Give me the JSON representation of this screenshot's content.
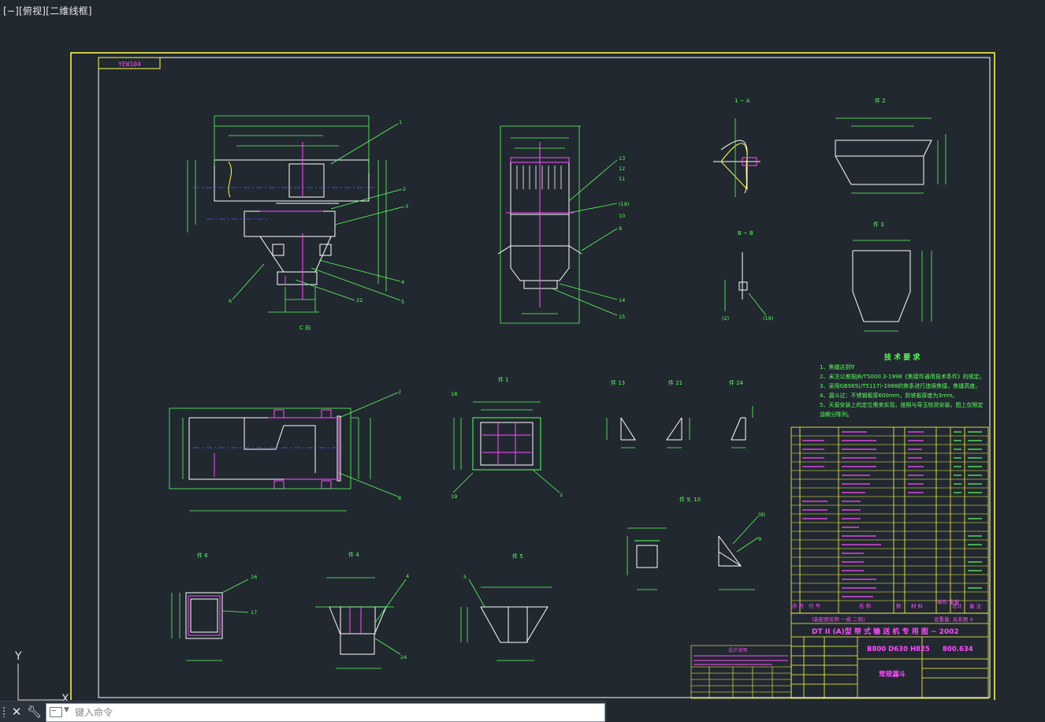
{
  "viewport": {
    "label": "[−][俯视][二维线框]"
  },
  "command_line": {
    "placeholder": "键入命令"
  },
  "ucs": {
    "y_label": "Y",
    "x_label": "X"
  },
  "drawing": {
    "corner_tag": "YEW104",
    "tech_title": "技 术 要 求",
    "tech_requirements": [
      "1、焦缝达到∇",
      "2、未注公差按JB/T5000.3-1998《焦接件通用技术条件》的规定。",
      "3、采用GB985(/T5117)-1988的焦条进行连续焦接，焦缝高度。",
      "4、漏斗过：不锈钢板厚600mm，防铁板厚度为3mm。",
      "5、天窗安装上的定位需来实现，按照与导玉校测安装，图上仅限定",
      "油稀分陈列。"
    ],
    "section_labels": [
      "1 − A",
      "B − B",
      "件 2",
      "件 3",
      "件 1",
      "件 4",
      "件 5",
      "件 6",
      "件 13",
      "件 21",
      "件 24",
      "件 9, 10",
      "C 向"
    ],
    "title_block": {
      "main_title": "DT II (A)型   带 式 输 送 机 专 用 图 − 2002",
      "spec": "B800 D630 H825",
      "code": "800.634",
      "name": "常规漏斗",
      "header_row": [
        "序 号",
        "代 号",
        "名 称",
        "数",
        "材 料",
        "单件 重量",
        "总计",
        "备 注"
      ],
      "weight_row": "总重量: 关系图 4",
      "assembly_note": "(装配图名称 一拖 二拖)"
    },
    "revision_title": "设计说明"
  }
}
